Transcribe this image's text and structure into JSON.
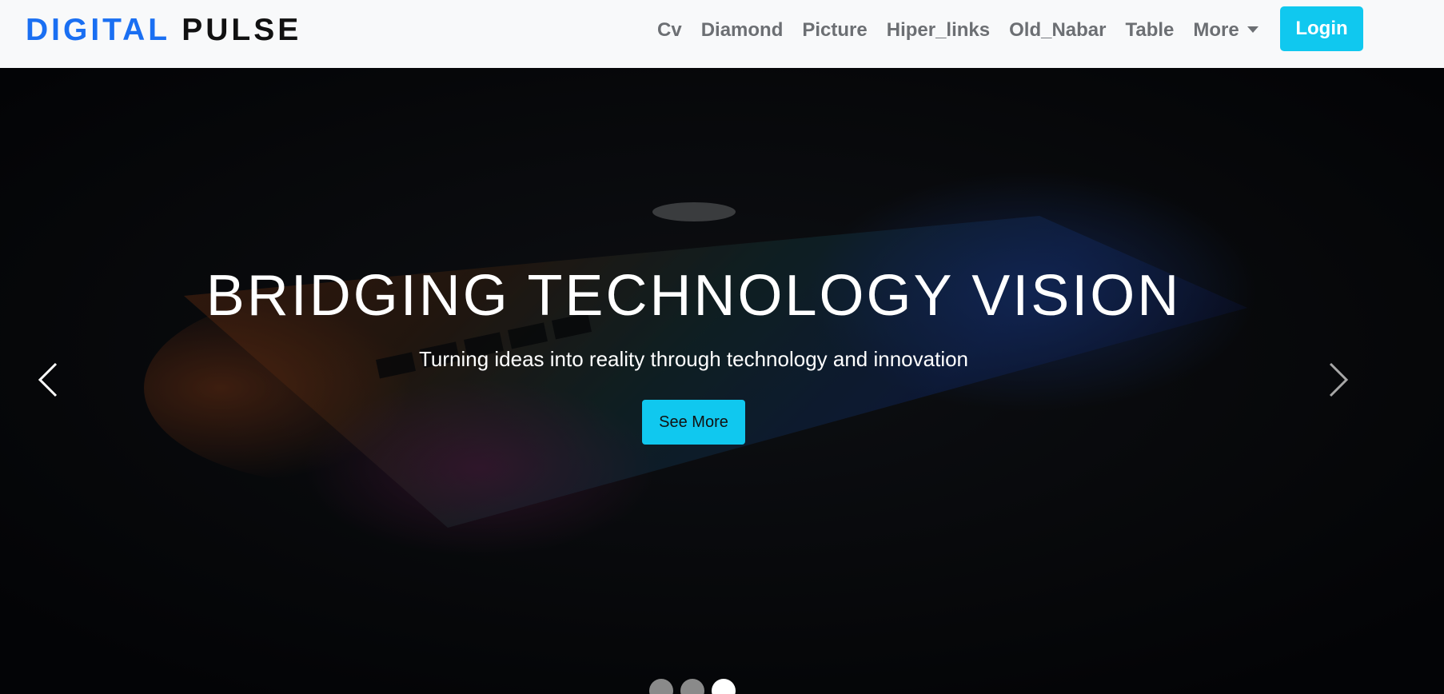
{
  "brand": {
    "part1": "DIGITAL",
    "part2": "PULSE"
  },
  "nav": {
    "items": [
      {
        "label": "Cv"
      },
      {
        "label": "Diamond"
      },
      {
        "label": "Picture"
      },
      {
        "label": "Hiper_links"
      },
      {
        "label": "Old_Nabar"
      },
      {
        "label": "Table"
      },
      {
        "label": "More"
      }
    ],
    "login_label": "Login"
  },
  "hero": {
    "title": "BRIDGING TECHNOLOGY VISION",
    "subtitle": "Turning ideas into reality through technology and innovation",
    "cta_label": "See More",
    "slides": 3,
    "active_slide": 3
  },
  "colors": {
    "brand_blue": "#1a6ff2",
    "accent_cyan": "#10c8ef",
    "navbar_bg": "#f8f9fa",
    "hero_bg": "#07080b"
  },
  "icons": {
    "prev": "chevron-left-icon",
    "next": "chevron-right-icon",
    "dropdown": "caret-down-icon"
  }
}
